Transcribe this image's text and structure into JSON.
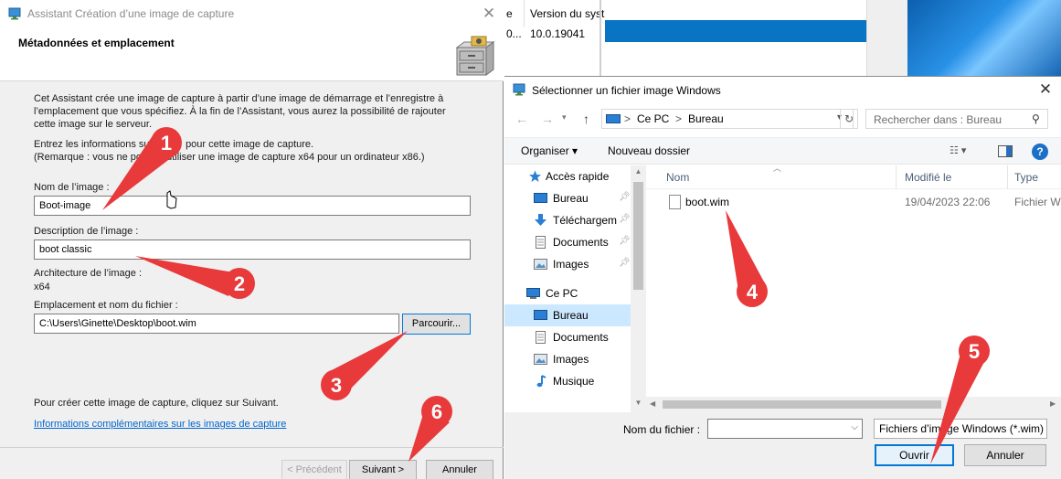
{
  "wizard": {
    "title": "Assistant Création d’une image de capture",
    "heading": "Métadonnées et emplacement",
    "intro": "Cet Assistant crée une image de capture à partir d’une image de démarrage et l’enregistre à l’emplacement que vous spécifiez. À la fin de l’Assistant, vous aurez la possibilité de rajouter cette image sur le serveur.",
    "enter_info_line1": "Entrez les informations sui",
    "enter_info_line1b": "pour cette image de capture.",
    "enter_info_line2": "(Remarque : vous ne po",
    "enter_info_line2b": "utiliser une image de capture x64 pour un ordinateur x86.)",
    "name_label": "Nom de l’image :",
    "name_value": "Boot-image",
    "description_label": "Description de l’image :",
    "description_value": "boot classic",
    "architecture_label": "Architecture de l’image :",
    "architecture_value": "x64",
    "location_label": "Emplacement et nom du fichier :",
    "location_value": "C:\\Users\\Ginette\\Desktop\\boot.wim",
    "browse_label": "Parcourir...",
    "next_hint": "Pour créer cette image de capture, cliquez sur Suivant.",
    "info_link": "Informations complémentaires sur les images de capture",
    "prev_label": "< Précédent",
    "next_label": "Suivant >",
    "cancel_label": "Annuler"
  },
  "background_window": {
    "col_prefix": "e",
    "column_header": "Version du syst",
    "row_prefix": "0...",
    "row_value": "10.0.19041"
  },
  "dialog": {
    "title": "Sélectionner un fichier image Windows",
    "address": {
      "pc": "Ce PC",
      "folder": "Bureau",
      "separator": ">"
    },
    "search_placeholder": "Rechercher dans : Bureau",
    "organize_label": "Organiser ▾",
    "new_folder_label": "Nouveau dossier",
    "help_label": "?",
    "nav_items": [
      {
        "label": "Accès rapide",
        "icon": "star-icon"
      },
      {
        "label": "Bureau",
        "icon": "desktop-icon",
        "pinned": true
      },
      {
        "label": "Téléchargements",
        "icon": "download-icon",
        "pinned": true
      },
      {
        "label": "Documents",
        "icon": "documents-icon",
        "pinned": true
      },
      {
        "label": "Images",
        "icon": "images-icon",
        "pinned": true
      },
      {
        "label": "Ce PC",
        "icon": "computer-icon"
      },
      {
        "label": "Bureau",
        "icon": "desktop-icon",
        "selected": true
      },
      {
        "label": "Documents",
        "icon": "documents-icon"
      },
      {
        "label": "Images",
        "icon": "images-icon"
      },
      {
        "label": "Musique",
        "icon": "music-icon"
      }
    ],
    "columns": {
      "name": "Nom",
      "modified": "Modifié le",
      "type": "Type"
    },
    "files": [
      {
        "name": "boot.wim",
        "modified": "19/04/2023 22:06",
        "type": "Fichier WIM"
      }
    ],
    "filename_label": "Nom du fichier :",
    "filename_value": "",
    "filetype_value": "Fichiers d’image Windows (*.wim)",
    "open_label": "Ouvrir",
    "cancel_label": "Annuler"
  },
  "callouts": [
    "1",
    "2",
    "3",
    "4",
    "5",
    "6"
  ],
  "colors": {
    "callout_red": "#e8393b",
    "selection_blue": "#0a74c4",
    "link_blue": "#0066cc",
    "accent_blue": "#0078d7"
  }
}
